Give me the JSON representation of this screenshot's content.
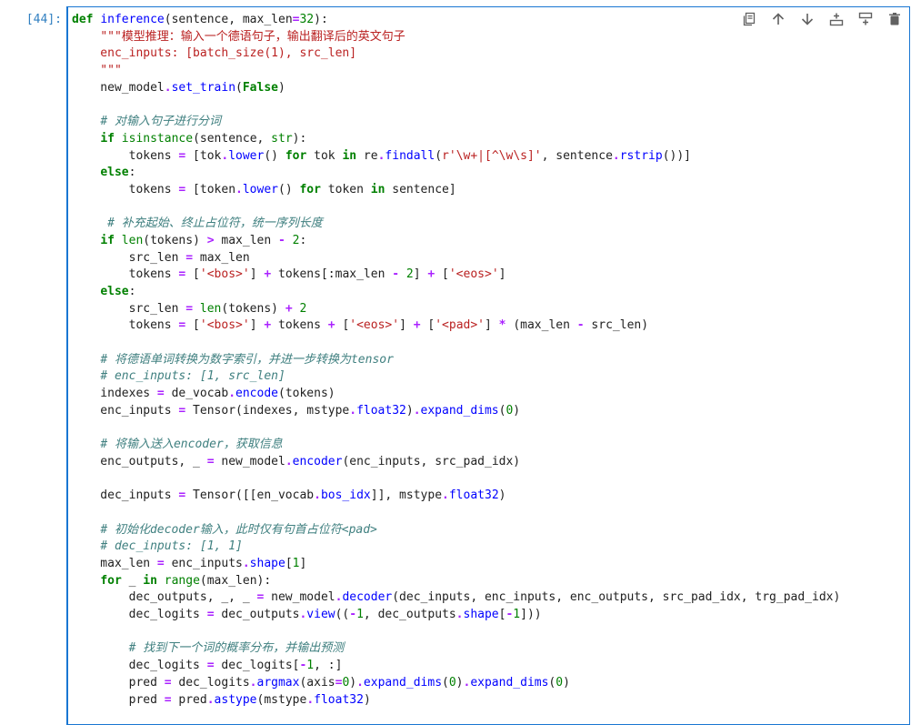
{
  "cell": {
    "prompt": "[44]:",
    "lines": [
      [
        {
          "t": "def",
          "c": "kw"
        },
        {
          "t": " "
        },
        {
          "t": "inference",
          "c": "fn"
        },
        {
          "t": "(sentence, max_len"
        },
        {
          "t": "=",
          "c": "op"
        },
        {
          "t": "32",
          "c": "num"
        },
        {
          "t": "):"
        }
      ],
      [
        {
          "t": "    "
        },
        {
          "t": "\"\"\"模型推理：输入一个德语句子，输出翻译后的英文句子",
          "c": "str"
        }
      ],
      [
        {
          "t": "    enc_inputs: [batch_size(1), src_len]",
          "c": "str"
        }
      ],
      [
        {
          "t": "    \"\"\"",
          "c": "str"
        }
      ],
      [
        {
          "t": "    new_model"
        },
        {
          "t": ".",
          "c": "op"
        },
        {
          "t": "set_train",
          "c": "fn"
        },
        {
          "t": "("
        },
        {
          "t": "False",
          "c": "kw"
        },
        {
          "t": ")"
        }
      ],
      [
        {
          "t": ""
        }
      ],
      [
        {
          "t": "    "
        },
        {
          "t": "# 对输入句子进行分词",
          "c": "cm"
        }
      ],
      [
        {
          "t": "    "
        },
        {
          "t": "if",
          "c": "kw"
        },
        {
          "t": " "
        },
        {
          "t": "isinstance",
          "c": "bi"
        },
        {
          "t": "(sentence, "
        },
        {
          "t": "str",
          "c": "bi"
        },
        {
          "t": "):"
        }
      ],
      [
        {
          "t": "        tokens "
        },
        {
          "t": "=",
          "c": "op"
        },
        {
          "t": " [tok"
        },
        {
          "t": ".",
          "c": "op"
        },
        {
          "t": "lower",
          "c": "fn"
        },
        {
          "t": "() "
        },
        {
          "t": "for",
          "c": "kw"
        },
        {
          "t": " tok "
        },
        {
          "t": "in",
          "c": "kw"
        },
        {
          "t": " re"
        },
        {
          "t": ".",
          "c": "op"
        },
        {
          "t": "findall",
          "c": "fn"
        },
        {
          "t": "("
        },
        {
          "t": "r'\\w+|[^\\w\\s]'",
          "c": "str"
        },
        {
          "t": ", sentence"
        },
        {
          "t": ".",
          "c": "op"
        },
        {
          "t": "rstrip",
          "c": "fn"
        },
        {
          "t": "())]"
        }
      ],
      [
        {
          "t": "    "
        },
        {
          "t": "else",
          "c": "kw"
        },
        {
          "t": ":"
        }
      ],
      [
        {
          "t": "        tokens "
        },
        {
          "t": "=",
          "c": "op"
        },
        {
          "t": " [token"
        },
        {
          "t": ".",
          "c": "op"
        },
        {
          "t": "lower",
          "c": "fn"
        },
        {
          "t": "() "
        },
        {
          "t": "for",
          "c": "kw"
        },
        {
          "t": " token "
        },
        {
          "t": "in",
          "c": "kw"
        },
        {
          "t": " sentence]"
        }
      ],
      [
        {
          "t": ""
        }
      ],
      [
        {
          "t": "     "
        },
        {
          "t": "# 补充起始、终止占位符，统一序列长度",
          "c": "cm"
        }
      ],
      [
        {
          "t": "    "
        },
        {
          "t": "if",
          "c": "kw"
        },
        {
          "t": " "
        },
        {
          "t": "len",
          "c": "bi"
        },
        {
          "t": "(tokens) "
        },
        {
          "t": ">",
          "c": "op"
        },
        {
          "t": " max_len "
        },
        {
          "t": "-",
          "c": "op"
        },
        {
          "t": " "
        },
        {
          "t": "2",
          "c": "num"
        },
        {
          "t": ":"
        }
      ],
      [
        {
          "t": "        src_len "
        },
        {
          "t": "=",
          "c": "op"
        },
        {
          "t": " max_len"
        }
      ],
      [
        {
          "t": "        tokens "
        },
        {
          "t": "=",
          "c": "op"
        },
        {
          "t": " ["
        },
        {
          "t": "'<bos>'",
          "c": "str"
        },
        {
          "t": "] "
        },
        {
          "t": "+",
          "c": "op"
        },
        {
          "t": " tokens[:max_len "
        },
        {
          "t": "-",
          "c": "op"
        },
        {
          "t": " "
        },
        {
          "t": "2",
          "c": "num"
        },
        {
          "t": "] "
        },
        {
          "t": "+",
          "c": "op"
        },
        {
          "t": " ["
        },
        {
          "t": "'<eos>'",
          "c": "str"
        },
        {
          "t": "]"
        }
      ],
      [
        {
          "t": "    "
        },
        {
          "t": "else",
          "c": "kw"
        },
        {
          "t": ":"
        }
      ],
      [
        {
          "t": "        src_len "
        },
        {
          "t": "=",
          "c": "op"
        },
        {
          "t": " "
        },
        {
          "t": "len",
          "c": "bi"
        },
        {
          "t": "(tokens) "
        },
        {
          "t": "+",
          "c": "op"
        },
        {
          "t": " "
        },
        {
          "t": "2",
          "c": "num"
        }
      ],
      [
        {
          "t": "        tokens "
        },
        {
          "t": "=",
          "c": "op"
        },
        {
          "t": " ["
        },
        {
          "t": "'<bos>'",
          "c": "str"
        },
        {
          "t": "] "
        },
        {
          "t": "+",
          "c": "op"
        },
        {
          "t": " tokens "
        },
        {
          "t": "+",
          "c": "op"
        },
        {
          "t": " ["
        },
        {
          "t": "'<eos>'",
          "c": "str"
        },
        {
          "t": "] "
        },
        {
          "t": "+",
          "c": "op"
        },
        {
          "t": " ["
        },
        {
          "t": "'<pad>'",
          "c": "str"
        },
        {
          "t": "] "
        },
        {
          "t": "*",
          "c": "op"
        },
        {
          "t": " (max_len "
        },
        {
          "t": "-",
          "c": "op"
        },
        {
          "t": " src_len)"
        }
      ],
      [
        {
          "t": ""
        }
      ],
      [
        {
          "t": "    "
        },
        {
          "t": "# 将德语单词转换为数字索引，并进一步转换为tensor",
          "c": "cm"
        }
      ],
      [
        {
          "t": "    "
        },
        {
          "t": "# enc_inputs: [1, src_len]",
          "c": "cm"
        }
      ],
      [
        {
          "t": "    indexes "
        },
        {
          "t": "=",
          "c": "op"
        },
        {
          "t": " de_vocab"
        },
        {
          "t": ".",
          "c": "op"
        },
        {
          "t": "encode",
          "c": "fn"
        },
        {
          "t": "(tokens)"
        }
      ],
      [
        {
          "t": "    enc_inputs "
        },
        {
          "t": "=",
          "c": "op"
        },
        {
          "t": " Tensor(indexes, mstype"
        },
        {
          "t": ".",
          "c": "op"
        },
        {
          "t": "float32",
          "c": "fn"
        },
        {
          "t": ")"
        },
        {
          "t": ".",
          "c": "op"
        },
        {
          "t": "expand_dims",
          "c": "fn"
        },
        {
          "t": "("
        },
        {
          "t": "0",
          "c": "num"
        },
        {
          "t": ")"
        }
      ],
      [
        {
          "t": ""
        }
      ],
      [
        {
          "t": "    "
        },
        {
          "t": "# 将输入送入encoder，获取信息",
          "c": "cm"
        }
      ],
      [
        {
          "t": "    enc_outputs, _ "
        },
        {
          "t": "=",
          "c": "op"
        },
        {
          "t": " new_model"
        },
        {
          "t": ".",
          "c": "op"
        },
        {
          "t": "encoder",
          "c": "fn"
        },
        {
          "t": "(enc_inputs, src_pad_idx)"
        }
      ],
      [
        {
          "t": ""
        }
      ],
      [
        {
          "t": "    dec_inputs "
        },
        {
          "t": "=",
          "c": "op"
        },
        {
          "t": " Tensor([[en_vocab"
        },
        {
          "t": ".",
          "c": "op"
        },
        {
          "t": "bos_idx",
          "c": "fn"
        },
        {
          "t": "]], mstype"
        },
        {
          "t": ".",
          "c": "op"
        },
        {
          "t": "float32",
          "c": "fn"
        },
        {
          "t": ")"
        }
      ],
      [
        {
          "t": ""
        }
      ],
      [
        {
          "t": "    "
        },
        {
          "t": "# 初始化decoder输入，此时仅有句首占位符<pad>",
          "c": "cm"
        }
      ],
      [
        {
          "t": "    "
        },
        {
          "t": "# dec_inputs: [1, 1]",
          "c": "cm"
        }
      ],
      [
        {
          "t": "    max_len "
        },
        {
          "t": "=",
          "c": "op"
        },
        {
          "t": " enc_inputs"
        },
        {
          "t": ".",
          "c": "op"
        },
        {
          "t": "shape",
          "c": "fn"
        },
        {
          "t": "["
        },
        {
          "t": "1",
          "c": "num"
        },
        {
          "t": "]"
        }
      ],
      [
        {
          "t": "    "
        },
        {
          "t": "for",
          "c": "kw"
        },
        {
          "t": " _ "
        },
        {
          "t": "in",
          "c": "kw"
        },
        {
          "t": " "
        },
        {
          "t": "range",
          "c": "bi"
        },
        {
          "t": "(max_len):"
        }
      ],
      [
        {
          "t": "        dec_outputs, _, _ "
        },
        {
          "t": "=",
          "c": "op"
        },
        {
          "t": " new_model"
        },
        {
          "t": ".",
          "c": "op"
        },
        {
          "t": "decoder",
          "c": "fn"
        },
        {
          "t": "(dec_inputs, enc_inputs, enc_outputs, src_pad_idx, trg_pad_idx)"
        }
      ],
      [
        {
          "t": "        dec_logits "
        },
        {
          "t": "=",
          "c": "op"
        },
        {
          "t": " dec_outputs"
        },
        {
          "t": ".",
          "c": "op"
        },
        {
          "t": "view",
          "c": "fn"
        },
        {
          "t": "(("
        },
        {
          "t": "-",
          "c": "op"
        },
        {
          "t": "1",
          "c": "num"
        },
        {
          "t": ", dec_outputs"
        },
        {
          "t": ".",
          "c": "op"
        },
        {
          "t": "shape",
          "c": "fn"
        },
        {
          "t": "["
        },
        {
          "t": "-",
          "c": "op"
        },
        {
          "t": "1",
          "c": "num"
        },
        {
          "t": "]))"
        }
      ],
      [
        {
          "t": ""
        }
      ],
      [
        {
          "t": "        "
        },
        {
          "t": "# 找到下一个词的概率分布，并输出预测",
          "c": "cm"
        }
      ],
      [
        {
          "t": "        dec_logits "
        },
        {
          "t": "=",
          "c": "op"
        },
        {
          "t": " dec_logits["
        },
        {
          "t": "-",
          "c": "op"
        },
        {
          "t": "1",
          "c": "num"
        },
        {
          "t": ", :]"
        }
      ],
      [
        {
          "t": "        pred "
        },
        {
          "t": "=",
          "c": "op"
        },
        {
          "t": " dec_logits"
        },
        {
          "t": ".",
          "c": "op"
        },
        {
          "t": "argmax",
          "c": "fn"
        },
        {
          "t": "(axis"
        },
        {
          "t": "=",
          "c": "op"
        },
        {
          "t": "0",
          "c": "num"
        },
        {
          "t": ")"
        },
        {
          "t": ".",
          "c": "op"
        },
        {
          "t": "expand_dims",
          "c": "fn"
        },
        {
          "t": "("
        },
        {
          "t": "0",
          "c": "num"
        },
        {
          "t": ")"
        },
        {
          "t": ".",
          "c": "op"
        },
        {
          "t": "expand_dims",
          "c": "fn"
        },
        {
          "t": "("
        },
        {
          "t": "0",
          "c": "num"
        },
        {
          "t": ")"
        }
      ],
      [
        {
          "t": "        pred "
        },
        {
          "t": "=",
          "c": "op"
        },
        {
          "t": " pred"
        },
        {
          "t": ".",
          "c": "op"
        },
        {
          "t": "astype",
          "c": "fn"
        },
        {
          "t": "(mstype"
        },
        {
          "t": ".",
          "c": "op"
        },
        {
          "t": "float32",
          "c": "fn"
        },
        {
          "t": ")"
        }
      ]
    ]
  },
  "toolbar": {
    "buttons": [
      {
        "name": "duplicate-cell-button",
        "icon": "copy-icon"
      },
      {
        "name": "move-cell-up-button",
        "icon": "arrow-up-icon"
      },
      {
        "name": "move-cell-down-button",
        "icon": "arrow-down-icon"
      },
      {
        "name": "insert-cell-above-button",
        "icon": "insert-above-icon"
      },
      {
        "name": "insert-cell-below-button",
        "icon": "insert-below-icon"
      },
      {
        "name": "delete-cell-button",
        "icon": "trash-icon"
      }
    ]
  },
  "colors": {
    "accent": "#1976d2",
    "prompt": "#307fc1",
    "icon": "#616161"
  }
}
